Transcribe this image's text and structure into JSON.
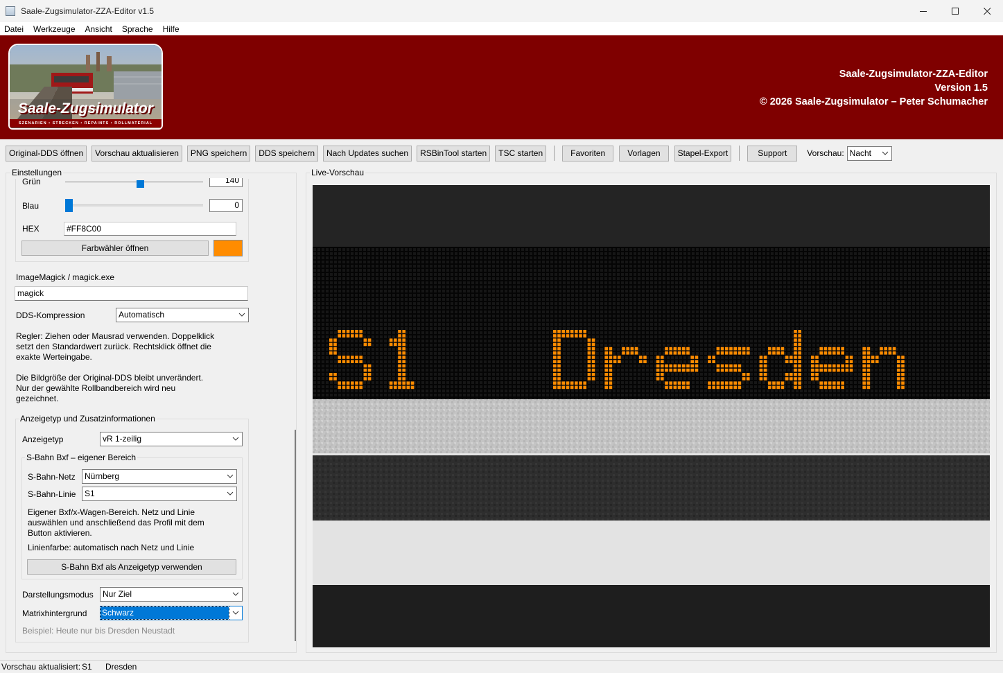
{
  "window": {
    "title": "Saale-Zugsimulator-ZZA-Editor v1.5"
  },
  "menu": [
    "Datei",
    "Werkzeuge",
    "Ansicht",
    "Sprache",
    "Hilfe"
  ],
  "banner": {
    "logo_text": "Saale-Zugsimulator",
    "logo_subtitle": "SZENARIEN • STRECKEN • REPAINTS • ROLLMATERIAL",
    "app_name": "Saale-Zugsimulator-ZZA-Editor",
    "version": "Version 1.5",
    "copyright": "© 2026 Saale-Zugsimulator – Peter Schumacher",
    "brand_color": "#7f0000"
  },
  "toolbar": {
    "open_dds": "Original-DDS öffnen",
    "refresh_preview": "Vorschau aktualisieren",
    "save_png": "PNG speichern",
    "save_dds": "DDS speichern",
    "check_updates": "Nach Updates suchen",
    "rsbintool": "RSBinTool starten",
    "tsc": "TSC starten",
    "favorites": "Favoriten",
    "templates": "Vorlagen",
    "batch_export": "Stapel-Export",
    "support": "Support",
    "preview_label": "Vorschau:",
    "preview_mode": "Nacht"
  },
  "settings": {
    "caption": "Einstellungen",
    "green_label": "Grün",
    "green_value": "140",
    "green_level": 0.55,
    "blue_label": "Blau",
    "blue_value": "0",
    "blue_level": 0,
    "hex_label": "HEX",
    "hex_value": "#FF8C00",
    "color_picker_button": "Farbwähler öffnen",
    "swatch_color": "#FF8C00",
    "imagemagick_label": "ImageMagick / magick.exe",
    "imagemagick_value": "magick",
    "dds_compression_label": "DDS-Kompression",
    "dds_compression_value": "Automatisch",
    "help_slider": [
      "Regler: Ziehen oder Mausrad verwenden. Doppelklick",
      "setzt den Standardwert zurück. Rechtsklick öffnet die",
      "exakte Werteingabe."
    ],
    "help_size": [
      "Die Bildgröße der Original-DDS bleibt unverändert.",
      "Nur der gewählte Rollbandbereich wird neu",
      "gezeichnet."
    ]
  },
  "display_type": {
    "caption": "Anzeigetyp und Zusatzinformationen",
    "type_label": "Anzeigetyp",
    "type_value": "vR 1-zeilig",
    "sbahn_caption": "S-Bahn Bxf – eigener Bereich",
    "network_label": "S-Bahn-Netz",
    "network_value": "Nürnberg",
    "line_label": "S-Bahn-Linie",
    "line_value": "S1",
    "sbahn_help": [
      "Eigener Bxf/x-Wagen-Bereich. Netz und Linie",
      "auswählen und anschließend das Profil mit dem",
      "Button aktivieren."
    ],
    "line_color_text": "Linienfarbe: automatisch nach Netz und Linie",
    "use_sbahn_button": "S-Bahn Bxf als Anzeigetyp verwenden",
    "mode_label": "Darstellungsmodus",
    "mode_value": "Nur Ziel",
    "matrix_bg_label": "Matrixhintergrund",
    "matrix_bg_value": "Schwarz",
    "example_text": "Beispiel: Heute nur bis Dresden Neustadt"
  },
  "preview": {
    "caption": "Live-Vorschau",
    "line_text": "S1",
    "destination_text": "Dresden",
    "led_color": "#FF8C00"
  },
  "status": {
    "label": "Vorschau aktualisiert:",
    "line": "S1",
    "destination": "Dresden"
  }
}
